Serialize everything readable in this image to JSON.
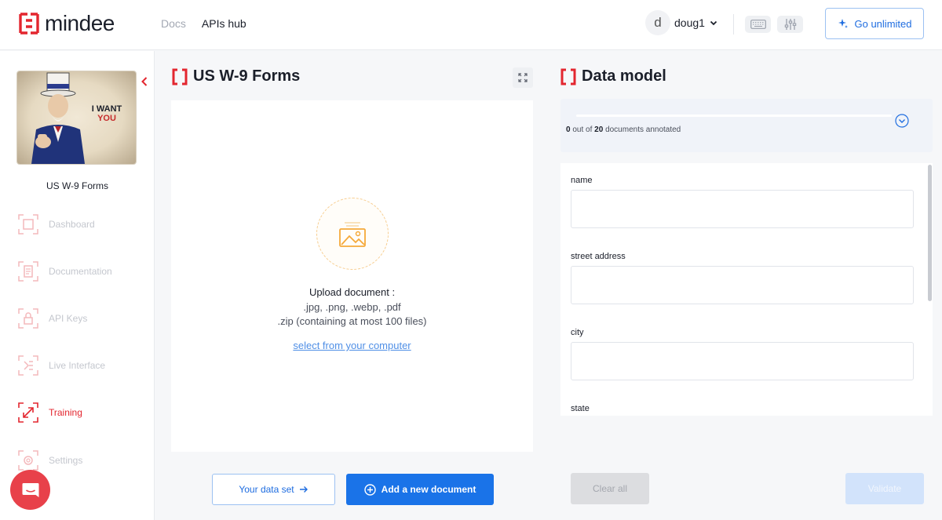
{
  "brand": {
    "name": "mindee",
    "accent": "#e3262f"
  },
  "nav": {
    "docs": "Docs",
    "apis_hub": "APIs hub"
  },
  "user": {
    "initial": "d",
    "name": "doug1"
  },
  "header": {
    "go_unlimited": "Go unlimited",
    "icons": [
      "keyboard-icon",
      "sliders-icon",
      "sparkle-icon"
    ]
  },
  "sidebar": {
    "project_name": "US W-9 Forms",
    "thumbnail_text": [
      "I WANT",
      "YOU"
    ],
    "items": [
      {
        "label": "Dashboard",
        "icon": "dashboard-icon",
        "active": false
      },
      {
        "label": "Documentation",
        "icon": "documentation-icon",
        "active": false
      },
      {
        "label": "API Keys",
        "icon": "lock-icon",
        "active": false
      },
      {
        "label": "Live Interface",
        "icon": "live-interface-icon",
        "active": false
      },
      {
        "label": "Training",
        "icon": "training-icon",
        "active": true
      },
      {
        "label": "Settings",
        "icon": "gear-icon",
        "active": false
      }
    ]
  },
  "upload": {
    "title": "US W-9 Forms",
    "heading": "Upload document :",
    "formats": ".jpg, .png, .webp, .pdf",
    "zip_note": ".zip (containing at most 100 files)",
    "link": "select from your computer",
    "dataset_button": "Your data set",
    "add_button": "Add a new document"
  },
  "data_model": {
    "title": "Data model",
    "annotated": 0,
    "total": 20,
    "progress_fraction": 0,
    "progress_prefix": "out of",
    "progress_suffix": "documents annotated",
    "fields": [
      {
        "label": "name",
        "value": ""
      },
      {
        "label": "street address",
        "value": ""
      },
      {
        "label": "city",
        "value": ""
      },
      {
        "label": "state",
        "value": ""
      }
    ],
    "clear_button": "Clear all",
    "validate_button": "Validate"
  }
}
